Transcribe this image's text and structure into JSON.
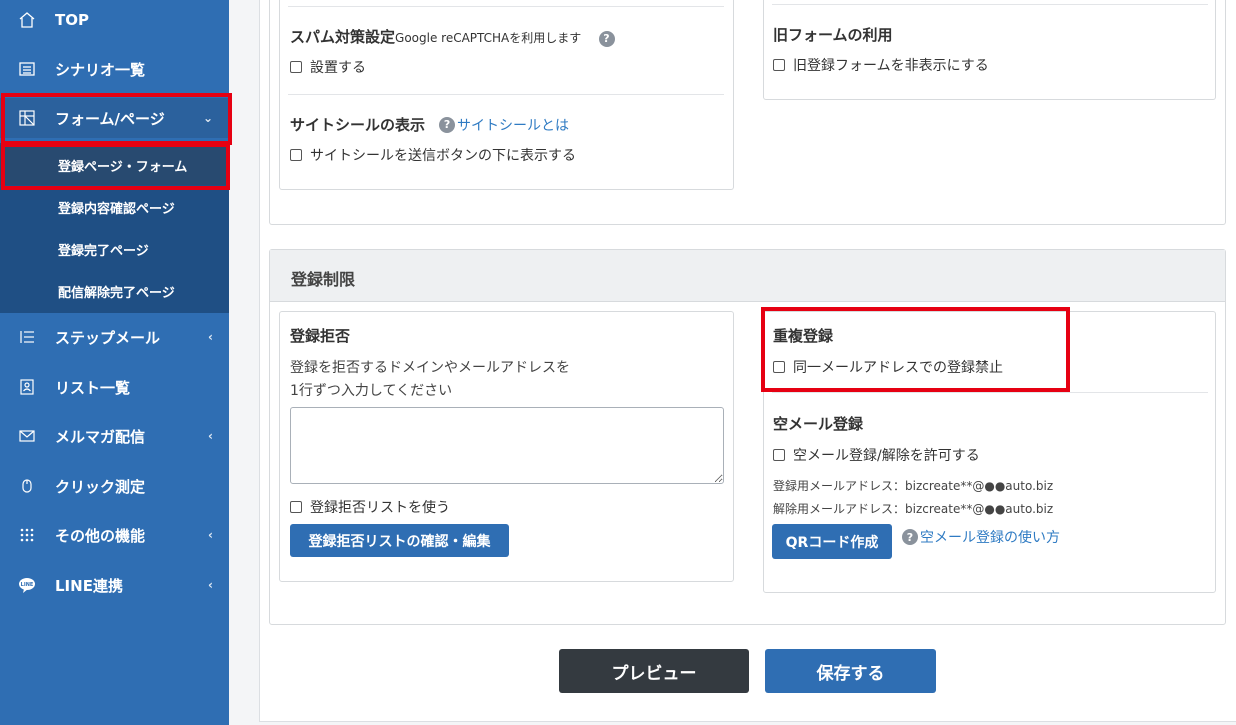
{
  "sidebar": {
    "items": [
      {
        "label": "TOP",
        "icon": "home-icon"
      },
      {
        "label": "シナリオ一覧",
        "icon": "list-icon"
      },
      {
        "label": "フォーム/ページ",
        "icon": "form-icon",
        "chevron": "⌄"
      },
      {
        "label": "ステップメール",
        "icon": "steps-icon",
        "chevron": "‹"
      },
      {
        "label": "リスト一覧",
        "icon": "contacts-icon"
      },
      {
        "label": "メルマガ配信",
        "icon": "mail-icon",
        "chevron": "‹"
      },
      {
        "label": "クリック測定",
        "icon": "mouse-icon"
      },
      {
        "label": "その他の機能",
        "icon": "grid-icon",
        "chevron": "‹"
      },
      {
        "label": "LINE連携",
        "icon": "line-icon",
        "chevron": "‹"
      }
    ],
    "submenu": [
      {
        "label": "登録ページ・フォーム"
      },
      {
        "label": "登録内容確認ページ"
      },
      {
        "label": "登録完了ページ"
      },
      {
        "label": "配信解除完了ページ"
      }
    ]
  },
  "top_panel": {
    "spam": {
      "title": "スパム対策設定",
      "note": "Google reCAPTCHAを利用します",
      "help": "?",
      "checkbox": "設置する"
    },
    "site_seal": {
      "title": "サイトシールの表示",
      "help": "?",
      "link": "サイトシールとは",
      "checkbox": "サイトシールを送信ボタンの下に表示する"
    },
    "old_form": {
      "title": "旧フォームの利用",
      "checkbox": "旧登録フォームを非表示にする"
    }
  },
  "restriction": {
    "header": "登録制限",
    "reject": {
      "title": "登録拒否",
      "desc1": "登録を拒否するドメインやメールアドレスを",
      "desc2": "1行ずつ入力してください",
      "textarea_value": "",
      "checkbox": "登録拒否リストを使う",
      "button": "登録拒否リストの確認・編集"
    },
    "duplicate": {
      "title": "重複登録",
      "checkbox": "同一メールアドレスでの登録禁止"
    },
    "empty_mail": {
      "title": "空メール登録",
      "checkbox": "空メール登録/解除を許可する",
      "register_addr": "登録用メールアドレス：bizcreate**@●●auto.biz",
      "cancel_addr": "解除用メールアドレス：bizcreate**@●●auto.biz",
      "qr_button": "QRコード作成",
      "help": "?",
      "howto_link": "空メール登録の使い方"
    }
  },
  "footer": {
    "preview": "プレビュー",
    "save": "保存する"
  },
  "colors": {
    "sidebar": "#2f6eb3",
    "submenu": "#1f4f84",
    "highlight": "#e60012",
    "primary_button": "#2f6eb3",
    "dark_button": "#343a40",
    "link": "#2f7bc3"
  }
}
